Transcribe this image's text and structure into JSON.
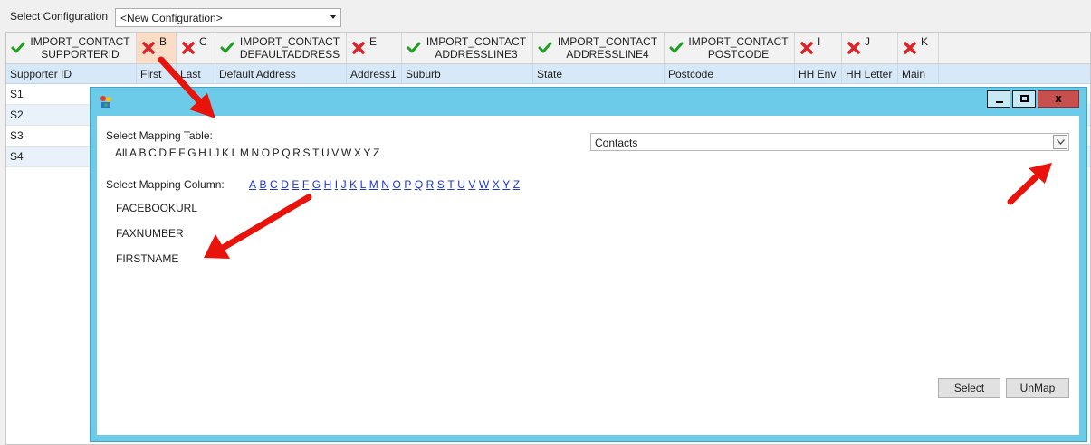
{
  "config": {
    "label": "Select Configuration",
    "value": "<New Configuration>"
  },
  "grid": {
    "header_columns": [
      {
        "status": "ok",
        "lines": [
          "IMPORT_CONTACT",
          "SUPPORTERID"
        ]
      },
      {
        "status": "error",
        "letter": "B",
        "selected": true
      },
      {
        "status": "error",
        "letter": "C"
      },
      {
        "status": "ok",
        "lines": [
          "IMPORT_CONTACT",
          "DEFAULTADDRESS"
        ]
      },
      {
        "status": "error",
        "letter": "E"
      },
      {
        "status": "ok",
        "lines": [
          "IMPORT_CONTACT",
          "ADDRESSLINE3"
        ]
      },
      {
        "status": "ok",
        "lines": [
          "IMPORT_CONTACT",
          "ADDRESSLINE4"
        ]
      },
      {
        "status": "ok",
        "lines": [
          "IMPORT_CONTACT",
          "POSTCODE"
        ]
      },
      {
        "status": "error",
        "letter": "I"
      },
      {
        "status": "error",
        "letter": "J"
      },
      {
        "status": "error",
        "letter": "K"
      }
    ],
    "sub_headers": [
      "Supporter ID",
      "First",
      "Last",
      "Default Address",
      "Address1",
      "Suburb",
      "State",
      "Postcode",
      "HH Env",
      "HH Letter",
      "Main"
    ],
    "rows": [
      "S1",
      "S2",
      "S3",
      "S4"
    ]
  },
  "dialog": {
    "table_label": "Select Mapping Table:",
    "table_letters": [
      "All",
      "A",
      "B",
      "C",
      "D",
      "E",
      "F",
      "G",
      "H",
      "I",
      "J",
      "K",
      "L",
      "M",
      "N",
      "O",
      "P",
      "Q",
      "R",
      "S",
      "T",
      "U",
      "V",
      "W",
      "X",
      "Y",
      "Z"
    ],
    "table_select_value": "Contacts",
    "column_label": "Select Mapping Column:",
    "column_letters": [
      "A",
      "B",
      "C",
      "D",
      "E",
      "F",
      "G",
      "H",
      "I",
      "J",
      "K",
      "L",
      "M",
      "N",
      "O",
      "P",
      "Q",
      "R",
      "S",
      "T",
      "U",
      "V",
      "W",
      "X",
      "Y",
      "Z"
    ],
    "columns": [
      "FACEBOOKURL",
      "FAXNUMBER",
      "FIRSTNAME"
    ],
    "select_button": "Select",
    "unmap_button": "UnMap",
    "close_glyph": "x"
  },
  "colors": {
    "ok": "#1f9e1f",
    "error": "#d9262b",
    "dialog_frame": "#6ccbe9",
    "link": "#1a33cc",
    "arrow": "#e8140c"
  }
}
